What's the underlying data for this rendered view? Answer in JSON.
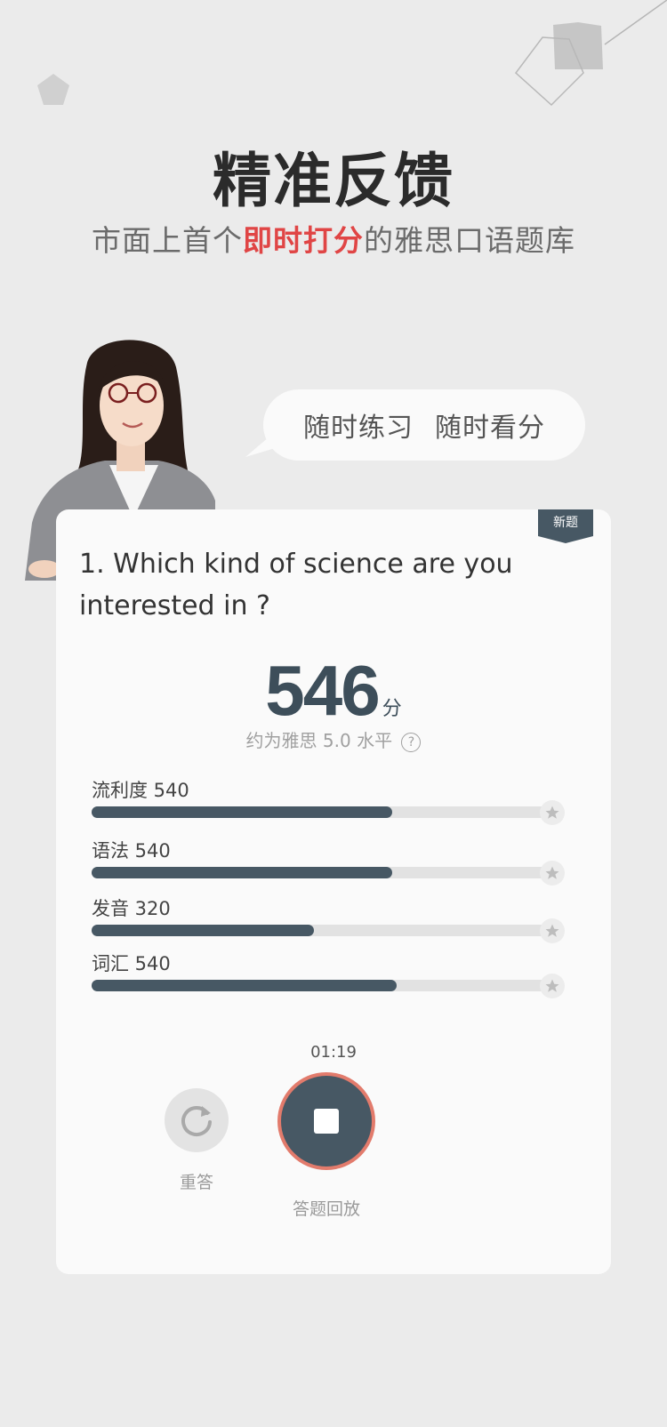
{
  "header": {
    "title": "精准反馈",
    "subtitle_pre": "市面上首个",
    "subtitle_highlight": "即时打分",
    "subtitle_post": "的雅思口语题库"
  },
  "bubble": {
    "phrase1": "随时练习",
    "phrase2": "随时看分"
  },
  "card": {
    "tag": "新题",
    "question": "1. Which kind of science are you interested in ?",
    "score": "546",
    "score_unit": "分",
    "level_text": "约为雅思 5.0 水平",
    "level_help": "?",
    "metrics": [
      {
        "label": "流利度 540",
        "fraction": 0.65
      },
      {
        "label": "语法 540",
        "fraction": 0.65
      },
      {
        "label": "发音 320",
        "fraction": 0.48
      },
      {
        "label": "词汇 540",
        "fraction": 0.66
      }
    ],
    "timer": "01:19",
    "redo_label": "重答",
    "playback_label": "答题回放"
  },
  "colors": {
    "background": "#ebebeb",
    "highlight": "#e04545",
    "bar_fill": "#475864",
    "bar_track": "#e2e2e2",
    "stop_ring": "#e27b6c"
  },
  "icons": {
    "redo": "redo-icon",
    "stop": "stop-icon",
    "star": "star-icon",
    "help": "question-icon"
  }
}
